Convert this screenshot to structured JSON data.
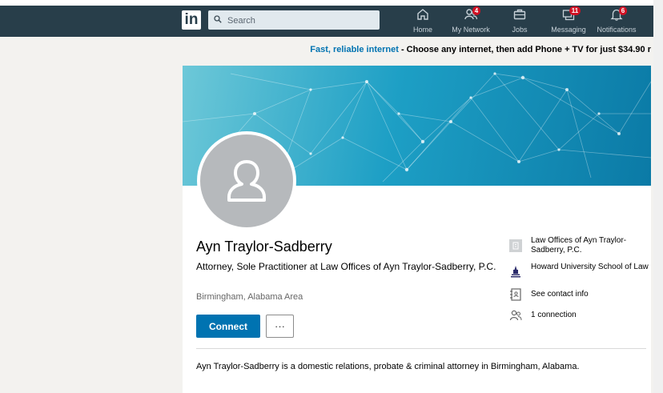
{
  "nav": {
    "logo": "in",
    "search_placeholder": "Search",
    "items": [
      {
        "label": "Home",
        "icon": "home-icon",
        "badge": ""
      },
      {
        "label": "My Network",
        "icon": "network-icon",
        "badge": "4"
      },
      {
        "label": "Jobs",
        "icon": "briefcase-icon",
        "badge": ""
      },
      {
        "label": "Messaging",
        "icon": "messaging-icon",
        "badge": "11"
      },
      {
        "label": "Notifications",
        "icon": "bell-icon",
        "badge": "6"
      }
    ]
  },
  "promo": {
    "link": "Fast, reliable internet",
    "separator": " - ",
    "text": "Choose any internet, then add Phone + TV for just $34.90 r"
  },
  "profile": {
    "name": "Ayn Traylor-Sadberry",
    "headline": "Attorney, Sole Practitioner at Law Offices of Ayn Traylor-Sadberry, P.C.",
    "location": "Birmingham, Alabama Area",
    "connect_label": "Connect",
    "more_label": "···",
    "summary": "Ayn Traylor-Sadberry is a domestic relations, probate & criminal attorney in Birmingham, Alabama."
  },
  "side": {
    "company": "Law Offices of Ayn Traylor-Sadberry, P.C.",
    "school": "Howard University School of Law",
    "contact": "See contact info",
    "connections": "1 connection"
  },
  "colors": {
    "nav_bg": "#283e4a",
    "brand_blue": "#0073b1",
    "badge_red": "#d11124"
  }
}
